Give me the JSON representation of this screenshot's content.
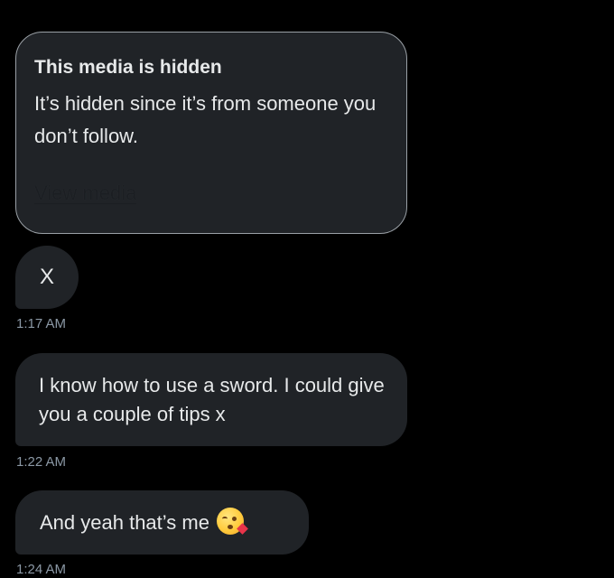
{
  "hidden_media": {
    "title": "This media is hidden",
    "body": "It’s hidden since it’s from someone you don’t follow.",
    "link_label": "View media"
  },
  "messages": [
    {
      "text": "X",
      "time": "1:17 AM"
    },
    {
      "text": "I know how to use a sword. I could give you a couple of tips x",
      "time": "1:22 AM"
    },
    {
      "text": "And yeah that’s me",
      "emoji": "kissing-face-with-heart-emoji",
      "time": "1:24 AM"
    }
  ],
  "colors": {
    "background": "#000000",
    "bubble": "#202327",
    "text": "#e7e9ea",
    "timestamp": "#8b98a5",
    "card_border": "#9aa0a6"
  }
}
